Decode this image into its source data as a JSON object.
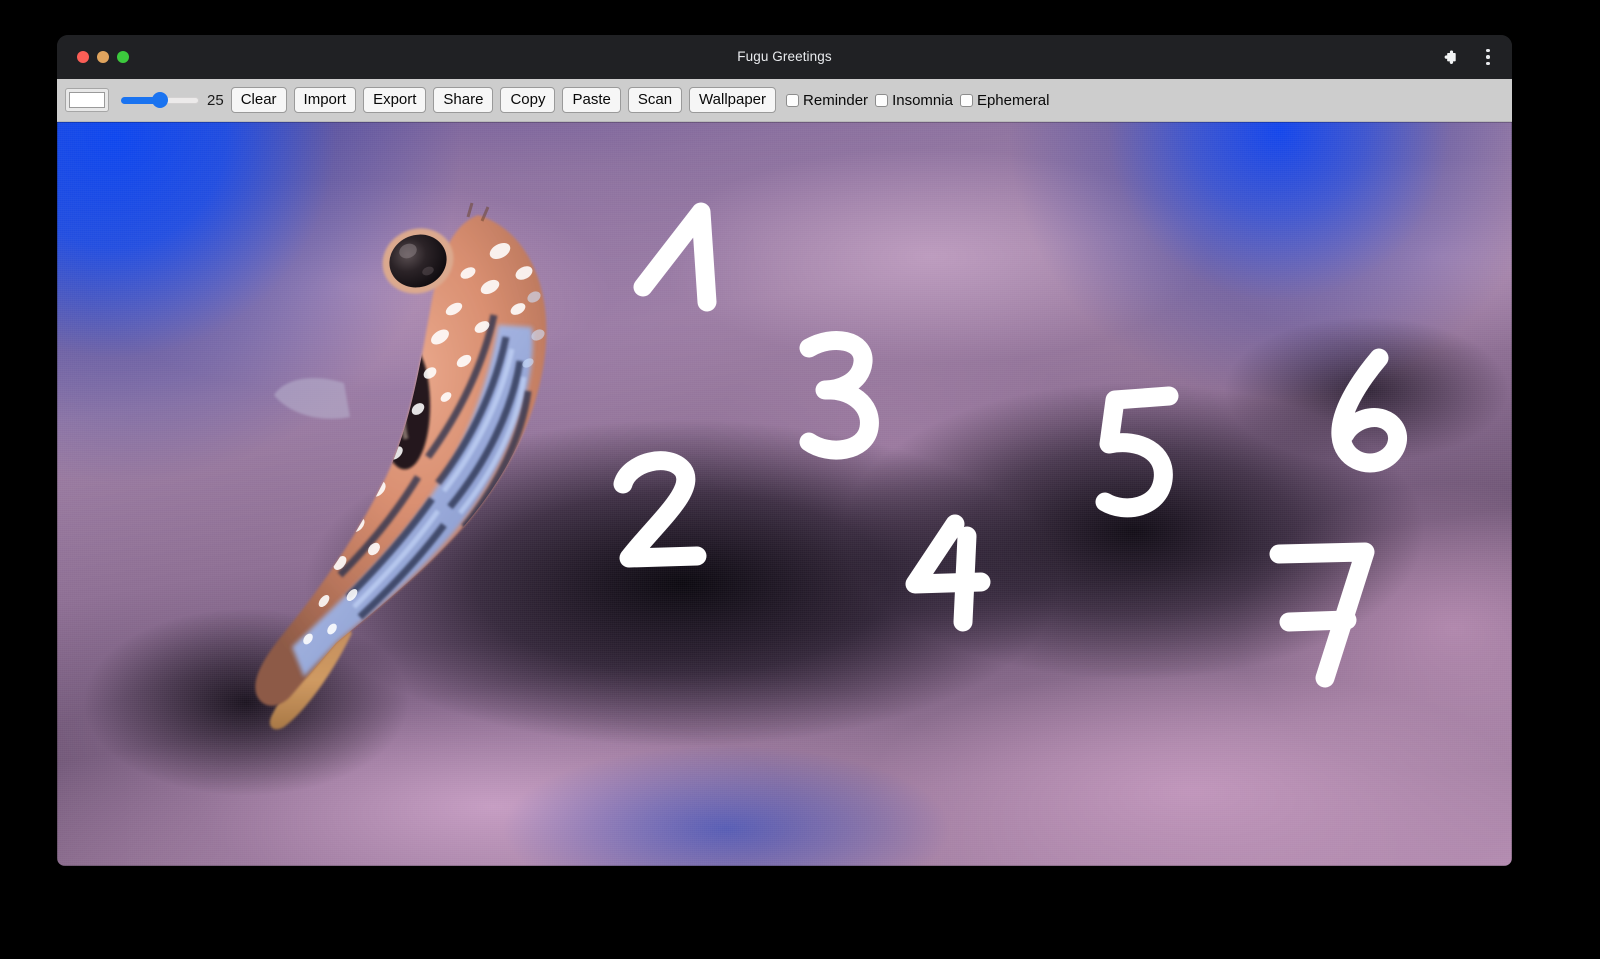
{
  "window": {
    "title": "Fugu Greetings",
    "traffic_lights": [
      {
        "name": "close",
        "color": "#fa5e56"
      },
      {
        "name": "minimize",
        "color": "#e0a45e"
      },
      {
        "name": "maximize",
        "color": "#3cc93d"
      }
    ],
    "titlebar_background": "#202124",
    "actions": [
      {
        "name": "extensions-icon",
        "glyph": "puzzle"
      },
      {
        "name": "browser-menu-icon",
        "glyph": "three-dots"
      }
    ]
  },
  "toolbar": {
    "background": "#cdcdcd",
    "color_picker": {
      "label": "color-picker",
      "value": "#ffffff"
    },
    "stroke_width_slider": {
      "label": "stroke-width",
      "value": 25,
      "min": 0,
      "max": 50,
      "accent": "#1a73f0",
      "display_value": "25"
    },
    "buttons": [
      {
        "id": "clear",
        "label": "Clear"
      },
      {
        "id": "import",
        "label": "Import"
      },
      {
        "id": "export",
        "label": "Export"
      },
      {
        "id": "share",
        "label": "Share"
      },
      {
        "id": "copy",
        "label": "Copy"
      },
      {
        "id": "paste",
        "label": "Paste"
      },
      {
        "id": "scan",
        "label": "Scan"
      },
      {
        "id": "wallpaper",
        "label": "Wallpaper"
      }
    ],
    "checkboxes": [
      {
        "id": "reminder",
        "label": "Reminder",
        "checked": false
      },
      {
        "id": "insomnia",
        "label": "Insomnia",
        "checked": false
      },
      {
        "id": "ephemeral",
        "label": "Ephemeral",
        "checked": false
      }
    ]
  },
  "canvas": {
    "name": "drawing-canvas",
    "background_image": "blurred underwater photo of a spotted pufferfish (fugu) over purple coral with blue water",
    "ink_color": "#ffffff",
    "annotations": [
      {
        "id": "stroke-1",
        "text": "1"
      },
      {
        "id": "stroke-2",
        "text": "2"
      },
      {
        "id": "stroke-3",
        "text": "3"
      },
      {
        "id": "stroke-4",
        "text": "4"
      },
      {
        "id": "stroke-5",
        "text": "5"
      },
      {
        "id": "stroke-6",
        "text": "6"
      },
      {
        "id": "stroke-7",
        "text": "7"
      }
    ]
  }
}
